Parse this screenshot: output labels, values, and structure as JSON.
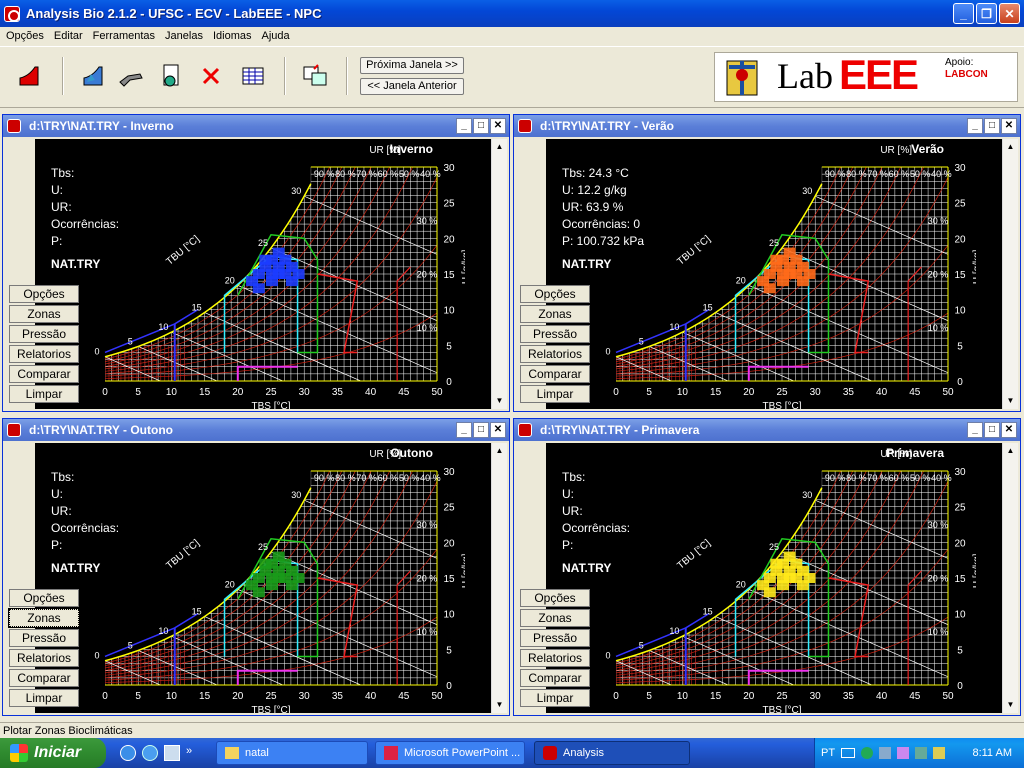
{
  "app": {
    "title": "Analysis Bio 2.1.2 - UFSC - ECV - LabEEE - NPC",
    "menu": [
      "Opções",
      "Editar",
      "Ferramentas",
      "Janelas",
      "Idiomas",
      "Ajuda"
    ],
    "toolbar": {
      "next_window": "Próxima Janela >>",
      "prev_window": "<< Janela Anterior"
    },
    "logo": {
      "lab": "Lab",
      "eee": "EEE",
      "support": "Apoio:",
      "sponsor": "LABCON"
    }
  },
  "windows": [
    {
      "title": "d:\\TRY\\NAT.TRY - Inverno",
      "season": "Inverno",
      "color": "#1c3cff",
      "info": {
        "tbs": "Tbs:",
        "u": "U:",
        "ur": "UR:",
        "occ": "Ocorrências:",
        "p": "P:",
        "dataset": "NAT.TRY"
      }
    },
    {
      "title": "d:\\TRY\\NAT.TRY - Verão",
      "season": "Verão",
      "color": "#ff6a1a",
      "info": {
        "tbs": "Tbs: 24.3 °C",
        "u": "U: 12.2 g/kg",
        "ur": "UR: 63.9 %",
        "occ": "Ocorrências: 0",
        "p": "P: 100.732 kPa",
        "dataset": "NAT.TRY"
      }
    },
    {
      "title": "d:\\TRY\\NAT.TRY - Outono",
      "season": "Outono",
      "color": "#1a9a1a",
      "info": {
        "tbs": "Tbs:",
        "u": "U:",
        "ur": "UR:",
        "occ": "Ocorrências:",
        "p": "P:",
        "dataset": "NAT.TRY"
      }
    },
    {
      "title": "d:\\TRY\\NAT.TRY - Primavera",
      "season": "Primavera",
      "color": "#ffe81a",
      "info": {
        "tbs": "Tbs:",
        "u": "U:",
        "ur": "UR:",
        "occ": "Ocorrências:",
        "p": "P:",
        "dataset": "NAT.TRY"
      }
    }
  ],
  "side_buttons": [
    "Opções",
    "Zonas",
    "Pressão",
    "Relatorios",
    "Comparar",
    "Limpar"
  ],
  "chart_labels": {
    "ur": "UR [%]",
    "tbu": "TBU [°C]",
    "tbs": "TBS [°C]",
    "u": "U [g/kg]",
    "x_ticks": [
      "0",
      "5",
      "10",
      "15",
      "20",
      "25",
      "30",
      "35",
      "40",
      "45",
      "50"
    ],
    "y_ticks": [
      "0",
      "5",
      "10",
      "15",
      "20",
      "25",
      "30"
    ],
    "rh_labels": [
      "90 %",
      "80 %",
      "70 %",
      "60 %",
      "50 %",
      "40 %"
    ],
    "rh_right": [
      "30 %",
      "20 %",
      "10 %"
    ],
    "wb_ticks": [
      "0",
      "5",
      "10",
      "15",
      "20",
      "25",
      "30"
    ]
  },
  "status": "Plotar Zonas Bioclimáticas",
  "taskbar": {
    "start": "Iniciar",
    "tasks": [
      "natal",
      "Microsoft PowerPoint ...",
      "Analysis"
    ],
    "lang": "PT",
    "clock": "8:11 AM"
  }
}
